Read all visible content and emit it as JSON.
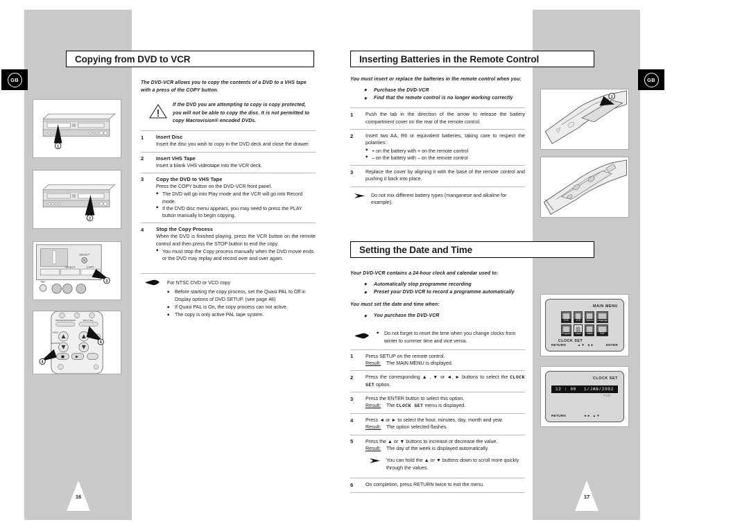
{
  "document": {
    "language_badge": "GB",
    "page_left": "16",
    "page_right": "17"
  },
  "left_page": {
    "title": "Copying from DVD to VCR",
    "intro": "The DVD-VCR allows you to copy the contents of a DVD to a VHS tape with a press of the COPY button.",
    "warning": {
      "icon": "warning-triangle-icon",
      "text": "If the DVD you are attempting to copy is copy protected, you will not be able to copy the disc. It is not permitted to copy Macrovision® encoded DVDs."
    },
    "steps": [
      {
        "num": "1",
        "heading": "Insert Disc",
        "text": "Insert the disc you wish to copy in the DVD deck and close the drawer.",
        "bullets": []
      },
      {
        "num": "2",
        "heading": "Insert VHS Tape",
        "text": "Insert a blank VHS videotape into the VCR deck.",
        "bullets": []
      },
      {
        "num": "3",
        "heading": "Copy the DVD to VHS Tape",
        "text": "Press the COPY button on the DVD-VCR front panel.",
        "bullets": [
          "The DVD will go into Play mode and the VCR will go into Record mode.",
          "If the DVD disc menu appears, you may need to press the PLAY button manually to begin copying."
        ]
      },
      {
        "num": "4",
        "heading": "Stop the Copy Process",
        "text": "When the DVD is finished playing, press the VCR button on the remote control and then press the STOP button to end the copy.",
        "bullets": [
          "You must stop the Copy process manually when the DVD movie ends or the DVD may replay and record over and over again."
        ]
      }
    ],
    "hand_note": {
      "icon": "pointing-hand-icon",
      "heading": "For NTSC DVD or VCD copy",
      "bullets": [
        "Before starting the copy process, set the Quasi PAL to Off in Display options of DVD SETUP. (see page 48)",
        "If Quasi PAL is On, the copy process can not active.",
        "The copy is only active PAL tape system."
      ]
    },
    "figures": [
      {
        "name": "dvd-vcr-front-panel-disc-slot",
        "callout": "1"
      },
      {
        "name": "dvd-vcr-front-panel-vhs-slot",
        "callout": "2"
      },
      {
        "name": "dvd-vcr-front-panel-copy-button",
        "callout": "3"
      },
      {
        "name": "remote-control-stop-vcr-buttons",
        "callout": "4"
      }
    ]
  },
  "right_page": {
    "batteries": {
      "title": "Inserting Batteries in the Remote Control",
      "intro": "You must insert or replace the batteries in the remote control when you:",
      "intro_bullets": [
        "Purchase the DVD-VCR",
        "Find that the remote control is no longer working correctly"
      ],
      "steps": [
        {
          "num": "1",
          "text": "Push the tab in the direction of the arrow to release the battery compartment cover on the rear of the remote control.",
          "bullets": []
        },
        {
          "num": "2",
          "text": "Insert two AA, R6 or equivalent batteries, taking care to respect the polarities:",
          "bullets": [
            "+ on the battery with + on the remote control",
            "– on the battery with – on the remote control"
          ]
        },
        {
          "num": "3",
          "text": "Replace the cover by aligning it with the base of the remote control and pushing it back into place.",
          "bullets": []
        }
      ],
      "tip": {
        "icon": "arrow-tip-icon",
        "text": "Do not mix different battery types (manganese and alkaline for example)."
      },
      "figures": [
        {
          "name": "remote-battery-cover-tab",
          "callout": "1"
        },
        {
          "name": "remote-battery-compartment-open",
          "callout": ""
        }
      ]
    },
    "datetime": {
      "title": "Setting the Date and Time",
      "intro": "Your DVD-VCR contains a 24-hour clock and calendar used to:",
      "intro_bullets": [
        "Automatically stop programme recording",
        "Preset your DVD-VCR to record a programme automatically"
      ],
      "intro2": "You must set the date and time when:",
      "intro2_bullets": [
        "You purchase the DVD-VCR"
      ],
      "hand_note": {
        "icon": "pointing-hand-icon",
        "bullets": [
          "Do not forget to reset the time when you change clocks from winter to summer time and vice versa."
        ]
      },
      "steps": [
        {
          "num": "1",
          "text": "Press SETUP on the remote control.",
          "result_label": "Result:",
          "result": "The MAIN MENU is displayed.",
          "bullets": []
        },
        {
          "num": "2",
          "text_pre": "Press the corresponding ▲ , ▼ or ◄, ► buttons to select the ",
          "keyword": "CLOCK SET",
          "text_post": " option.",
          "bullets": []
        },
        {
          "num": "3",
          "text": "Press the ENTER button to select this option.",
          "result_label": "Result:",
          "result_pre": "The ",
          "keyword": "CLOCK SET",
          "result_post": " menu is displayed.",
          "bullets": []
        },
        {
          "num": "4",
          "text": "Press ◄ or ► to select the hour, minutes, day, month and year.",
          "result_label": "Result:",
          "result": "The option selected flashes.",
          "bullets": []
        },
        {
          "num": "5",
          "text": "Press the ▲ or ▼ buttons to increase or decrease the value.",
          "result_label": "Result:",
          "result": "The day of the week is displayed automatically.",
          "tip": "You can hold the ▲ or ▼ buttons down to scroll more quickly through the values.",
          "bullets": []
        },
        {
          "num": "6",
          "text": "On completion, press RETURN twice to exit the menu.",
          "bullets": []
        }
      ],
      "osd_main_menu": {
        "title": "MAIN MENU",
        "icons": [
          "DVD",
          "VCR",
          "System",
          "Language",
          "Program",
          "Clock",
          "Install",
          "Exit"
        ],
        "selected_icon": "Clock",
        "selected_label": "CLOCK SET",
        "footer_return": "RETURN",
        "footer_nav": "▲▼ ◄►",
        "footer_enter": "ENTER"
      },
      "osd_clock_set": {
        "title": "CLOCK SET",
        "time": "12 : 00",
        "date": "1/JAN/2002",
        "day_of_week": "TUE",
        "footer_return": "RETURN",
        "footer_nav": "◄►  ▲▼"
      }
    }
  },
  "colors": {
    "band_gray": "#c9c9c9",
    "rule_gray": "#b8b8b8",
    "figure_border": "#a9a9a9",
    "osd_bg": "#d7d7d7"
  }
}
